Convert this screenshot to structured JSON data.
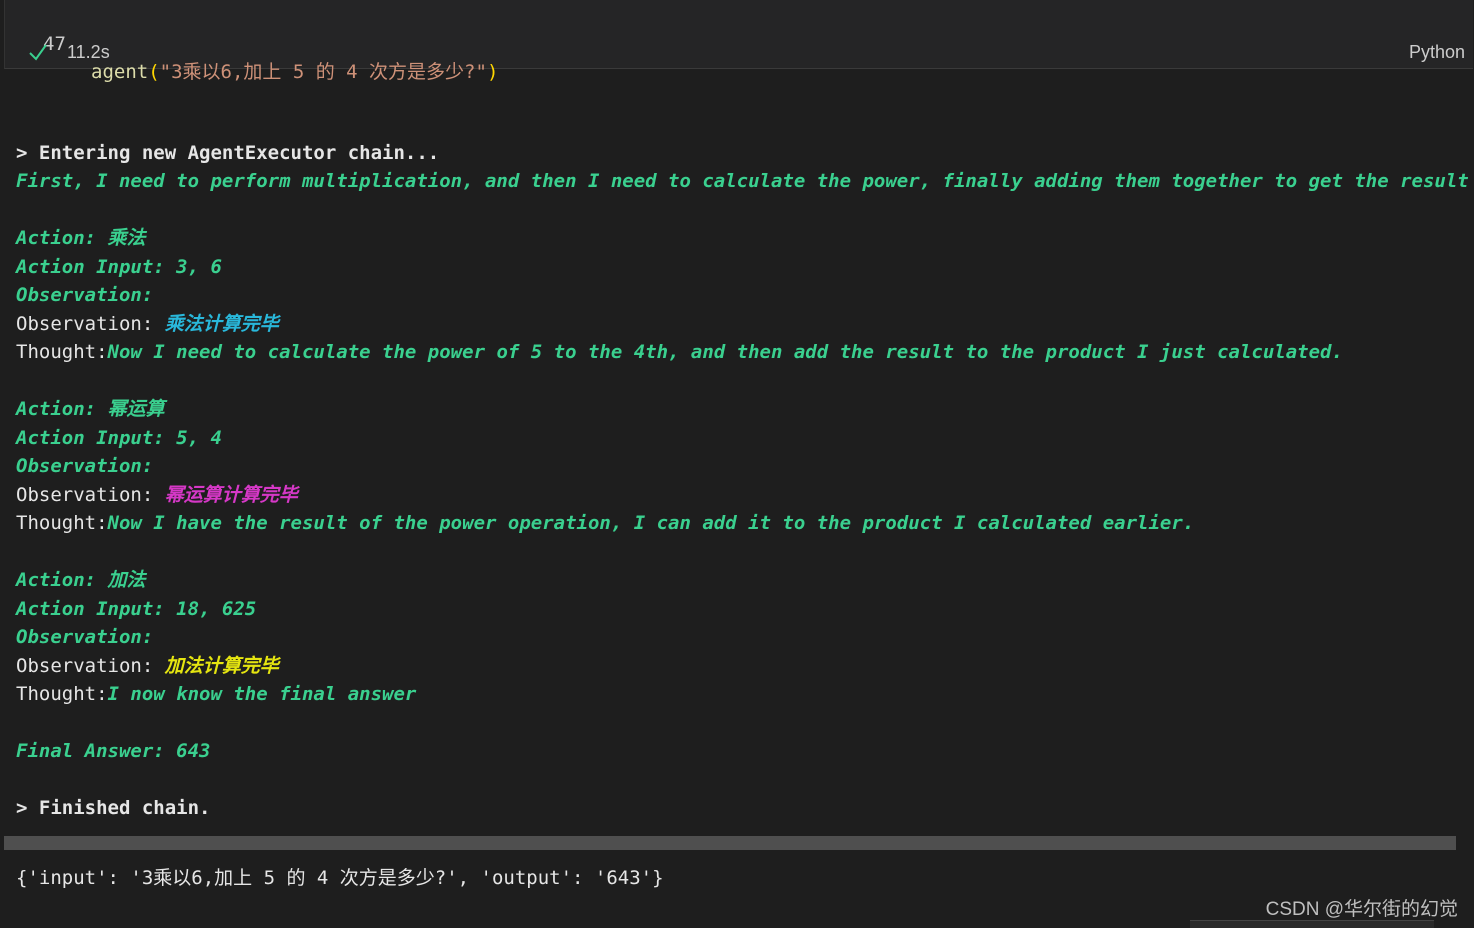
{
  "cell": {
    "line_number": "47",
    "code_fn": "agent",
    "code_open": "(",
    "code_string": "\"3乘以6,加上 5 的 4 次方是多少?\"",
    "code_close": ")",
    "exec_time": "11.2s",
    "language": "Python"
  },
  "output": {
    "entering": "> Entering new AgentExecutor chain...",
    "first_thought": "First, I need to perform multiplication, and then I need to calculate the power, finally adding them together to get the result",
    "steps": [
      {
        "action": "Action: 乘法",
        "action_input": "Action Input: 3, 6",
        "observation_label": "Observation:",
        "observation_prefix": "Observation: ",
        "observation_value": "乘法计算完毕",
        "thought_prefix": "Thought:",
        "thought_text": "Now I need to calculate the power of 5 to the 4th, and then add the result to the product I just calculated."
      },
      {
        "action": "Action: 幂运算",
        "action_input": "Action Input: 5, 4",
        "observation_label": "Observation:",
        "observation_prefix": "Observation: ",
        "observation_value": "幂运算计算完毕",
        "thought_prefix": "Thought:",
        "thought_text": "Now I have the result of the power operation, I can add it to the product I calculated earlier."
      },
      {
        "action": "Action: 加法",
        "action_input": "Action Input: 18, 625",
        "observation_label": "Observation:",
        "observation_prefix": "Observation: ",
        "observation_value": "加法计算完毕",
        "thought_prefix": "Thought:",
        "thought_text": "I now know the final answer"
      }
    ],
    "final_answer": "Final Answer: 643",
    "finished": "> Finished chain.",
    "result": "{'input': '3乘以6,加上 5 的 4 次方是多少?', 'output': '643'}"
  },
  "watermark": "CSDN @华尔街的幻觉",
  "colors": {
    "green": "#3ad08f",
    "cyan": "#29b8db",
    "magenta": "#d638c7",
    "yellow": "#e5e510"
  },
  "icons": {
    "status": "checkmark-icon"
  }
}
